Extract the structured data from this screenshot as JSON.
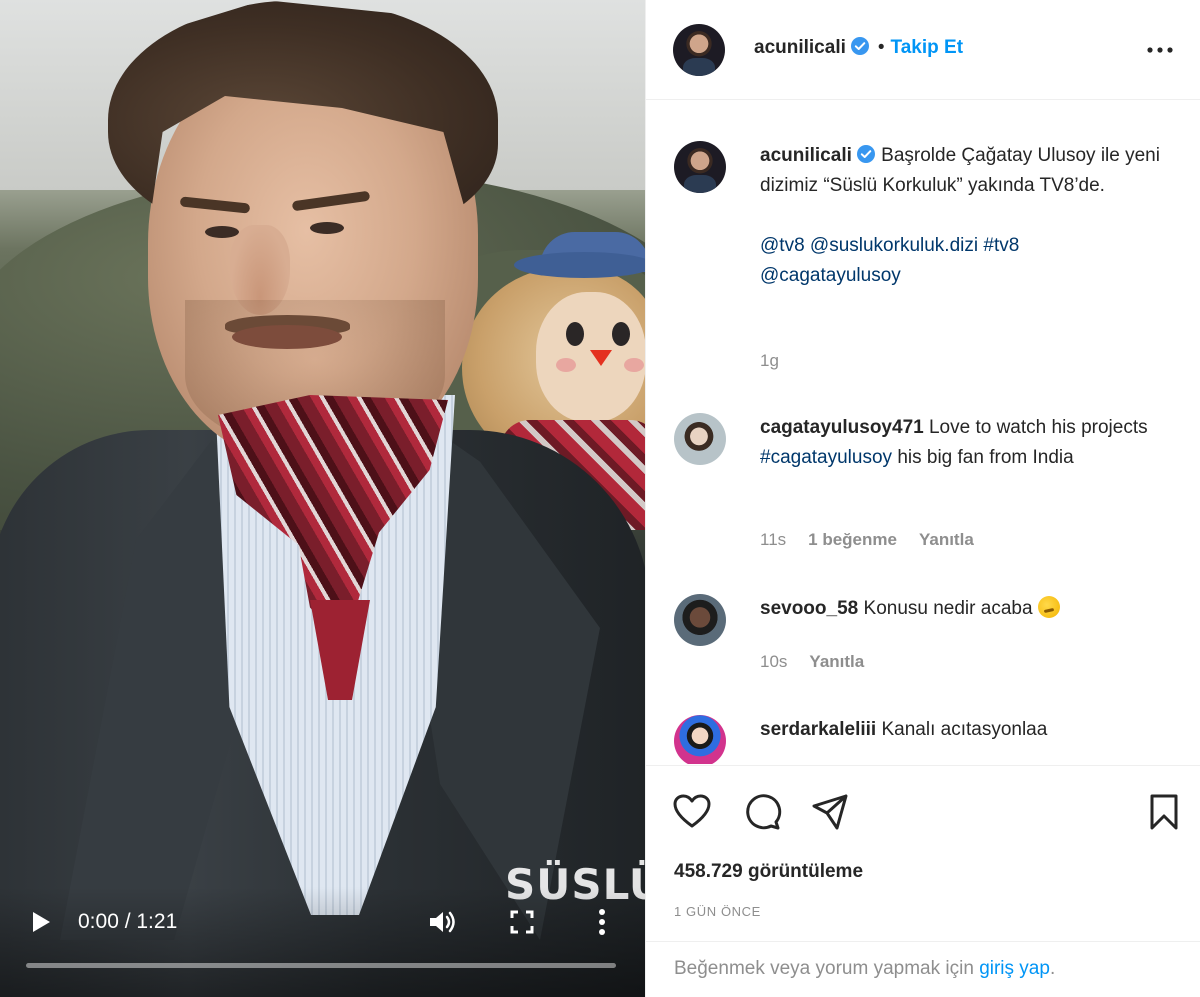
{
  "video": {
    "watermark": "SÜSLÜ",
    "time_display": "0:00 / 1:21",
    "progress": 0.0
  },
  "post": {
    "author": "acunilicali",
    "verified": true,
    "follow_label": "Takip Et",
    "caption_line": "Başrolde Çağatay Ulusoy ile yeni dizimiz “Süslü Korkuluk” yakında TV8’de.",
    "mentions_1": "@tv8 @suslukorkuluk.dizi #tv8",
    "mentions_2": "@cagatayulusoy",
    "caption_age": "1g"
  },
  "comments": [
    {
      "username": "cagatayulusoy471",
      "text_before": "Love to watch his projects ",
      "hashtag": "#cagatayulusoy",
      "text_after": " his big fan from India",
      "age": "11s",
      "likes": "1 beğenme",
      "reply": "Yanıtla"
    },
    {
      "username": "sevooo_58",
      "text": "Konusu nedir acaba",
      "emoji": "thinking-face",
      "age": "10s",
      "reply": "Yanıtla"
    },
    {
      "username": "serdarkaleliii",
      "text": "Kanalı acıtasyonlaa"
    }
  ],
  "stats": {
    "views": "458.729 görüntüleme",
    "date": "1 GÜN ÖNCE"
  },
  "login": {
    "prefix": "Beğenmek veya yorum yapmak için ",
    "link": "giriş yap",
    "suffix": "."
  },
  "icons": {
    "like": "heart-icon",
    "comment": "comment-icon",
    "share": "send-icon",
    "save": "bookmark-icon",
    "more": "more-horizontal-icon",
    "verified": "verified-badge-icon"
  },
  "colors": {
    "link_blue": "#0095f6",
    "hashtag_blue": "#00376b",
    "muted": "#8e8e8e",
    "verified": "#3897f0"
  }
}
